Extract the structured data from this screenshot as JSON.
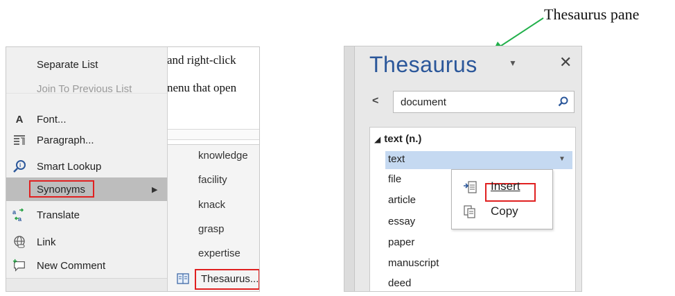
{
  "context_menu": {
    "items": [
      {
        "label": "Separate List",
        "icon": ""
      },
      {
        "label": "Join To Previous List",
        "icon": "",
        "disabled": true
      },
      {
        "label": "Font...",
        "icon": "font-icon"
      },
      {
        "label": "Paragraph...",
        "icon": "paragraph-icon"
      },
      {
        "label": "Smart Lookup",
        "icon": "smart-lookup-icon"
      },
      {
        "label": "Synonyms",
        "icon": "",
        "highlighted": true
      },
      {
        "label": "Translate",
        "icon": "translate-icon"
      },
      {
        "label": "Link",
        "icon": "link-icon"
      },
      {
        "label": "New Comment",
        "icon": "new-comment-icon"
      }
    ],
    "font_icon_glyph": "A"
  },
  "document": {
    "line1": "and right-click",
    "line2": "nenu that open"
  },
  "synonyms_submenu": {
    "items": [
      "knowledge",
      "facility",
      "knack",
      "grasp",
      "expertise"
    ],
    "thesaurus_label": "Thesaurus..."
  },
  "callout": {
    "label": "Thesaurus pane",
    "arrow_color": "#22b04b"
  },
  "thesaurus_pane": {
    "title": "Thesaurus",
    "title_color": "#2b579a",
    "dropdown_glyph": "▼",
    "close_glyph": "✕",
    "back_glyph": "<",
    "search_value": "document",
    "group_heading": "text (n.)",
    "group_toggle_glyph": "◢",
    "selected_word": "text",
    "selected_dropdown_glyph": "▼",
    "words": [
      "file",
      "article",
      "essay",
      "paper",
      "manuscript",
      "deed"
    ]
  },
  "popup_menu": {
    "insert_label": "Insert",
    "copy_label": "Copy"
  },
  "colors": {
    "highlight_box": "#e02020",
    "selection": "#c5d9f1"
  }
}
